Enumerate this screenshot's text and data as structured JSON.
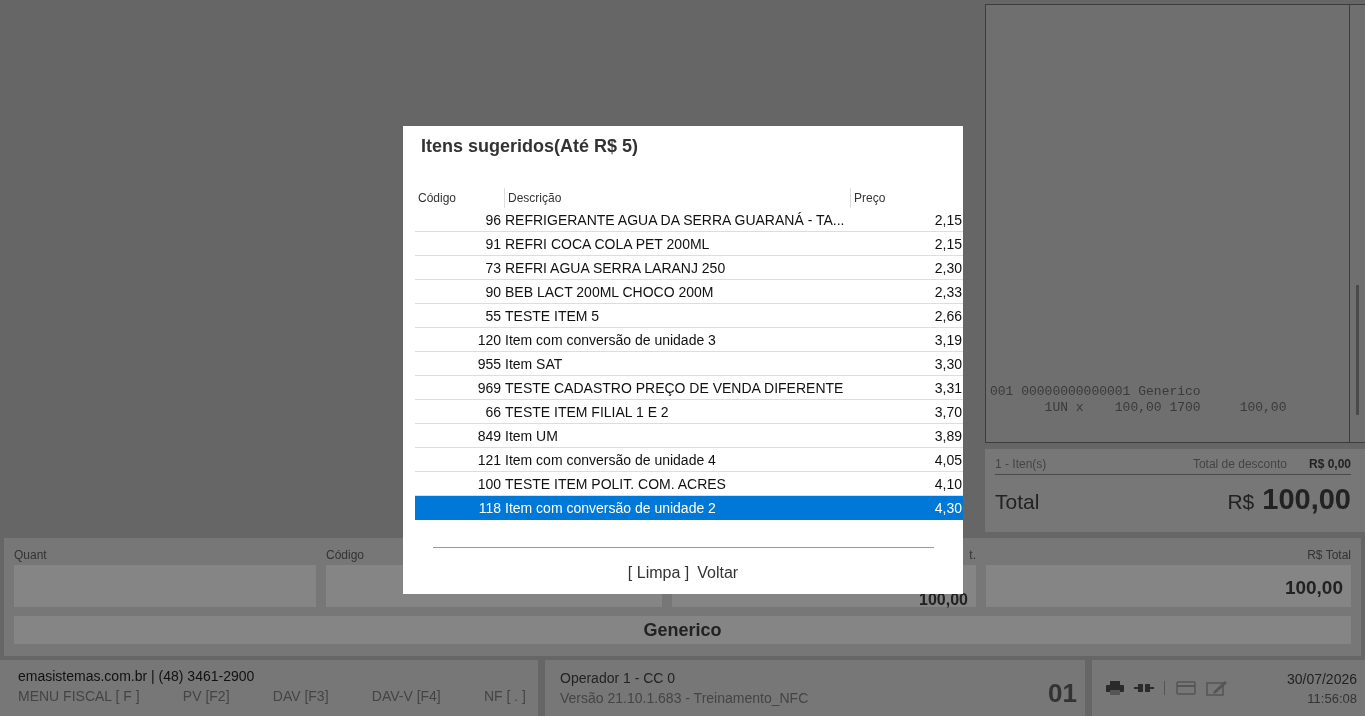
{
  "receipt": {
    "lines": [
      "001 00000000000001 Generico",
      "       1UN x    100,00 1700     100,00"
    ]
  },
  "totals": {
    "items": "1 - Iten(s)",
    "discount_label": "Total de desconto",
    "discount": "R$ 0,00",
    "total_label": "Total",
    "currency": "R$",
    "total": "100,00"
  },
  "entry": {
    "fields": [
      {
        "label": "Quant"
      },
      {
        "label": "Código"
      },
      {
        "label": "t.",
        "value": "100,00"
      },
      {
        "label": "R$ Total",
        "value": "100,00"
      }
    ],
    "product": "Generico"
  },
  "status_bar": {
    "site": "emasistemas.com.br | (48) 3461-2900",
    "shortcuts": [
      "MENU FISCAL [ F ]",
      "PV [F2]",
      "DAV [F3]",
      "DAV-V [F4]",
      "NF [ . ]"
    ],
    "operator": "Operador 1 - CC 0",
    "version": "Versão 21.10.1.683 - Treinamento_NFC",
    "terminal": "01",
    "date": "30/07/2026",
    "time": "11:56:08"
  },
  "modal": {
    "title": "Itens sugeridos(Até R$ 5)",
    "columns": [
      "Código",
      "Descrição",
      "Preço"
    ],
    "rows": [
      {
        "code": "96",
        "description": "REFRIGERANTE AGUA DA SERRA GUARANÁ - TA...",
        "price": "2,15",
        "selected": false
      },
      {
        "code": "91",
        "description": "REFRI COCA COLA PET 200ML",
        "price": "2,15",
        "selected": false
      },
      {
        "code": "73",
        "description": "REFRI AGUA SERRA LARANJ 250",
        "price": "2,30",
        "selected": false
      },
      {
        "code": "90",
        "description": "BEB LACT 200ML CHOCO 200M",
        "price": "2,33",
        "selected": false
      },
      {
        "code": "55",
        "description": "TESTE ITEM 5",
        "price": "2,66",
        "selected": false
      },
      {
        "code": "120",
        "description": "Item com conversão de unidade 3",
        "price": "3,19",
        "selected": false
      },
      {
        "code": "955",
        "description": "Item SAT",
        "price": "3,30",
        "selected": false
      },
      {
        "code": "969",
        "description": "TESTE CADASTRO PREÇO DE VENDA DIFERENTE",
        "price": "3,31",
        "selected": false
      },
      {
        "code": "66",
        "description": "TESTE ITEM FILIAL 1 E 2",
        "price": "3,70",
        "selected": false
      },
      {
        "code": "849",
        "description": "Item UM",
        "price": "3,89",
        "selected": false
      },
      {
        "code": "121",
        "description": "Item com conversão de unidade 4",
        "price": "4,05",
        "selected": false
      },
      {
        "code": "100",
        "description": "TESTE ITEM POLIT. COM. ACRES",
        "price": "4,10",
        "selected": false
      },
      {
        "code": "118",
        "description": "Item com conversão de unidade 2",
        "price": "4,30",
        "selected": true
      }
    ],
    "actions": [
      "[ Limpa ]",
      "Voltar"
    ]
  }
}
